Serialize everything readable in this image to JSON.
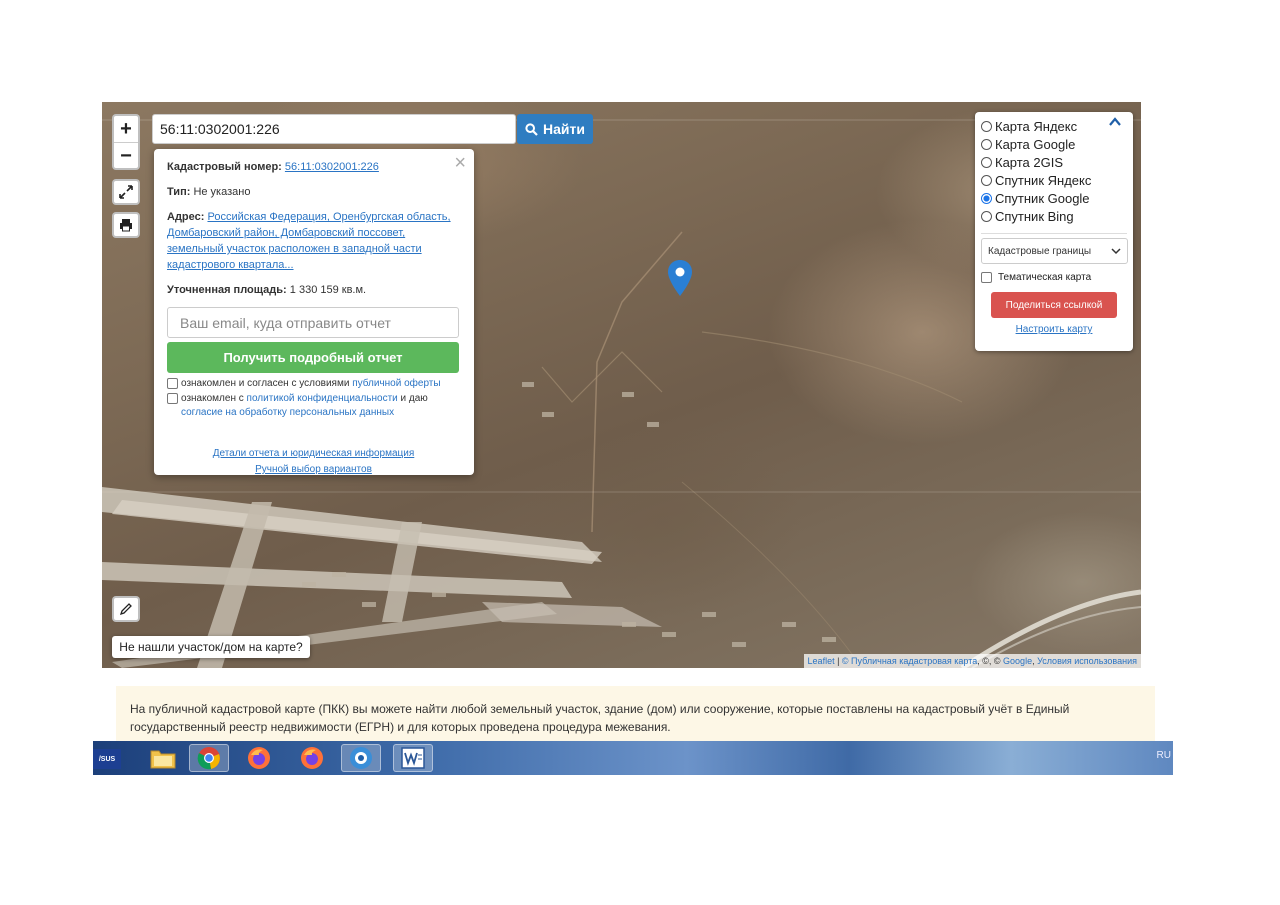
{
  "search": {
    "value": "56:11:0302001:226",
    "button_label": "Найти"
  },
  "zoom": {
    "in_label": "+",
    "out_label": "−"
  },
  "popup": {
    "close_label": "×",
    "cad_label": "Кадастровый номер:",
    "cad_value": "56:11:0302001:226",
    "type_label": "Тип:",
    "type_value": "Не указано",
    "address_label": "Адрес:",
    "address_value": "Российская Федерация, Оренбургская область, Домбаровский район, Домбаровский поссовет, земельный участок расположен в западной части кадастрового квартала...",
    "area_label": "Уточненная площадь:",
    "area_value": "1 330 159 кв.м.",
    "email_placeholder": "Ваш email, куда отправить отчет",
    "report_button": "Получить подробный отчет",
    "consent1_text": "ознакомлен и согласен с условиями",
    "consent1_link": "публичной оферты",
    "consent2_text": "ознакомлен с",
    "consent2_link1": "политикой конфиденциальности",
    "consent2_mid": "и даю",
    "consent2_link2": "согласие на обработку персональных данных",
    "link_details": "Детали отчета и юридическая информация",
    "link_manual": "Ручной выбор вариантов"
  },
  "layers": {
    "options": [
      {
        "label": "Карта Яндекс",
        "selected": false
      },
      {
        "label": "Карта Google",
        "selected": false
      },
      {
        "label": "Карта 2GIS",
        "selected": false
      },
      {
        "label": "Спутник Яндекс",
        "selected": false
      },
      {
        "label": "Спутник Google",
        "selected": true
      },
      {
        "label": "Спутник Bing",
        "selected": false
      }
    ],
    "select_value": "Кадастровые границы",
    "thematic_label": "Тематическая карта",
    "share_button": "Поделиться ссылкой",
    "setup_link": "Настроить карту"
  },
  "not_found_button": "Не нашли участок/дом на карте?",
  "attribution": {
    "leaflet": "Leaflet",
    "pkk": "© Публичная кадастровая карта",
    "middle": ", ©, ©",
    "google": "Google",
    "terms": "Условия использования"
  },
  "info_text": "На публичной кадастровой карте (ПКК) вы можете найти любой земельный участок, здание (дом) или сооружение, которые поставлены на кадастровый учёт в Единый государственный реестр недвижимости (ЕГРН) и для которых проведена процедура межевания.",
  "taskbar": {
    "brand": "/SUS",
    "lang": "RU"
  },
  "colors": {
    "search_button": "#2f7dc1",
    "report_button": "#5cb85c",
    "share_button": "#d9534f",
    "link": "#2a74c4",
    "pin": "#2a7fd4",
    "info_bg": "#fdf7e6"
  }
}
